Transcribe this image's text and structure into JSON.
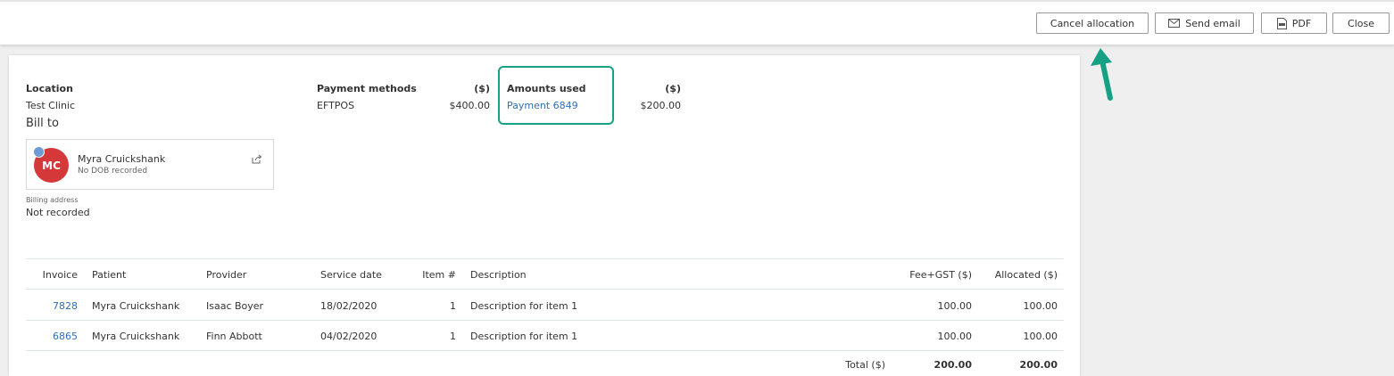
{
  "toolbar": {
    "cancel_allocation": "Cancel allocation",
    "send_email": "Send email",
    "pdf": "PDF",
    "close": "Close",
    "icons": [
      "envelope-icon",
      "pdf-icon"
    ]
  },
  "details": {
    "location_label": "Location",
    "location_value": "Test Clinic",
    "bill_to_label": "Bill to",
    "payment_methods_label": "Payment methods",
    "payment_methods_unit": "($)",
    "payment_method_name": "EFTPOS",
    "payment_method_amount": "$400.00",
    "amounts_used_label": "Amounts used",
    "amounts_used_unit": "($)",
    "amount_used_link": "Payment 6849",
    "amount_used_value": "$200.00"
  },
  "patient": {
    "initials": "MC",
    "name": "Myra Cruickshank",
    "dob": "No DOB recorded",
    "billing_address_label": "Billing address",
    "billing_address_value": "Not recorded"
  },
  "table": {
    "headers": {
      "invoice": "Invoice",
      "patient": "Patient",
      "provider": "Provider",
      "service_date": "Service date",
      "item": "Item #",
      "description": "Description",
      "fee": "Fee+GST ($)",
      "allocated": "Allocated ($)"
    },
    "rows": [
      {
        "invoice": "7828",
        "patient": "Myra Cruickshank",
        "provider": "Isaac Boyer",
        "service_date": "18/02/2020",
        "item": "1",
        "description": "Description for item 1",
        "fee": "100.00",
        "allocated": "100.00"
      },
      {
        "invoice": "6865",
        "patient": "Myra Cruickshank",
        "provider": "Finn Abbott",
        "service_date": "04/02/2020",
        "item": "1",
        "description": "Description for item 1",
        "fee": "100.00",
        "allocated": "100.00"
      }
    ],
    "total_label": "Total ($)",
    "total_fee": "200.00",
    "total_allocated": "200.00"
  },
  "colors": {
    "link": "#2f6fb8",
    "highlight": "#16a185",
    "avatar": "#d43838"
  }
}
